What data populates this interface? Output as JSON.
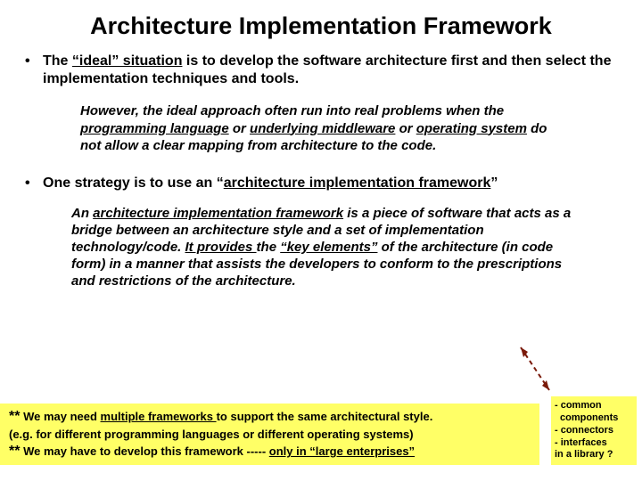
{
  "title": "Architecture Implementation Framework",
  "bullet1": {
    "pre": "The ",
    "ideal": "“ideal” situation",
    "post": " is to develop the software architecture first and then select the implementation techniques and tools."
  },
  "sub1": {
    "l1a": "However, the ideal approach often run into real problems when the ",
    "u1": "programming language",
    "l1b": " or ",
    "u2": "underlying middleware",
    "l1c": " or ",
    "u3": "operating system",
    "l1d": " do not allow a clear mapping from architecture to the code."
  },
  "bullet2": {
    "pre": "One strategy is to use an ",
    "q1": "“",
    "u": "architecture implementation framework",
    "q2": "”"
  },
  "sub2": {
    "a": "An ",
    "u1": "architecture implementation framework",
    "b": " is a piece of software that acts as a bridge between an architecture style and a set of implementation technology/code. ",
    "u2": "It provides ",
    "c": "the ",
    "u3": "“key elements”",
    "d": " of the architecture (in code form) in a manner that assists the developers to conform to the prescriptions and restrictions of the architecture."
  },
  "footer": {
    "a1": "**",
    "t1a": " We may need ",
    "u1": "multiple frameworks ",
    "t1b": "to support the same architectural style.",
    "t2": "(e.g. for different programming languages or different operating systems)",
    "a2": "**",
    "t3a": " We may have to develop this framework ----- ",
    "u2": "only in “large enterprises”"
  },
  "sidebox": {
    "l1": "- common",
    "l2": "components",
    "l3": "- connectors",
    "l4": "- interfaces",
    "l5": "in a library ?"
  }
}
